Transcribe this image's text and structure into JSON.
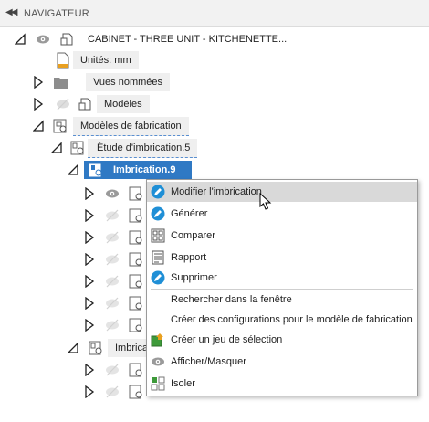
{
  "header": {
    "title": "NAVIGATEUR",
    "collapse_icon": "double-chevron-left-icon"
  },
  "tree": {
    "root": {
      "label": "CABINET - THREE UNIT -  KITCHENETTE..."
    },
    "units": {
      "label": "Unités: mm"
    },
    "named_views": {
      "label": "Vues nommées"
    },
    "models": {
      "label": "Modèles"
    },
    "manufacturing_models": {
      "label": "Modèles de fabrication"
    },
    "nesting_study": {
      "label": "Étude d'imbrication.5"
    },
    "nest": {
      "label": "Imbrication.9"
    },
    "nest2": {
      "label": "Imbrica"
    }
  },
  "context_menu": {
    "items": [
      {
        "label": "Modifier l'imbrication",
        "icon": "edit-nest-icon"
      },
      {
        "label": "Générer",
        "icon": "generate-icon"
      },
      {
        "label": "Comparer",
        "icon": "compare-icon"
      },
      {
        "label": "Rapport",
        "icon": "report-icon"
      },
      {
        "label": "Supprimer",
        "icon": "delete-icon"
      },
      {
        "label": "Rechercher dans la fenêtre"
      },
      {
        "label": "Créer des configurations pour le modèle de fabrication"
      },
      {
        "label": "Créer un jeu de sélection",
        "icon": "selection-set-icon"
      },
      {
        "label": "Afficher/Masquer",
        "icon": "eye-icon"
      },
      {
        "label": "Isoler",
        "icon": "isolate-icon"
      }
    ]
  },
  "colors": {
    "accent": "#2f79c4",
    "hover": "#d9d9d9"
  }
}
